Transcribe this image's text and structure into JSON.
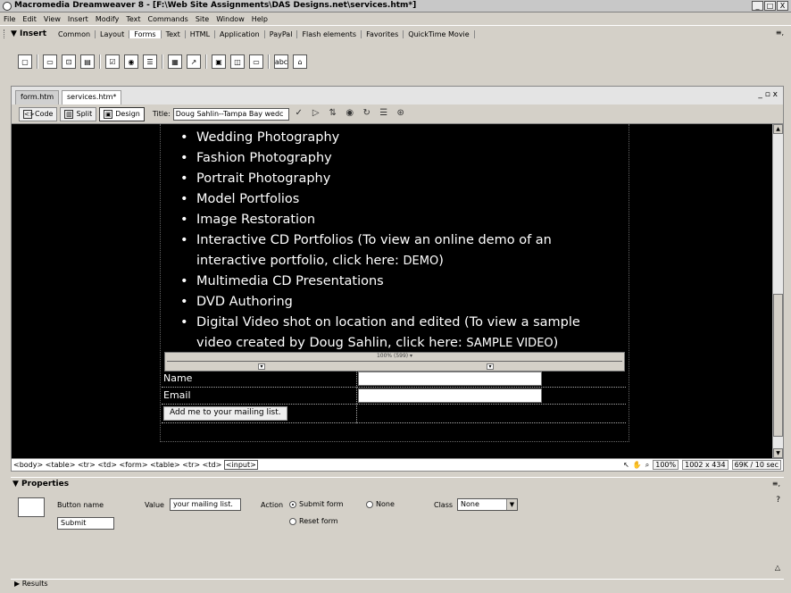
{
  "window": {
    "title": "Macromedia Dreamweaver 8 - [F:\\Web Site Assignments\\DAS Designs.net\\services.htm*]",
    "controls": [
      "_",
      "□",
      "X"
    ]
  },
  "menubar": [
    "File",
    "Edit",
    "View",
    "Insert",
    "Modify",
    "Text",
    "Commands",
    "Site",
    "Window",
    "Help"
  ],
  "insert_bar": {
    "label": "▼ Insert",
    "tabs": [
      "Common",
      "Layout",
      "Forms",
      "Text",
      "HTML",
      "Application",
      "PayPal",
      "Flash elements",
      "Favorites",
      "QuickTime Movie"
    ],
    "active_tab": "Forms",
    "menu_glyph": "≡,"
  },
  "document": {
    "tabs": [
      "form.htm",
      "services.htm*"
    ],
    "active_tab": "services.htm*",
    "window_controls": "_ ▫ x",
    "views": [
      {
        "label": "Code"
      },
      {
        "label": "Split"
      },
      {
        "label": "Design"
      }
    ],
    "active_view": "Design",
    "title_label": "Title:",
    "title_value": "Doug Sahlin--Tampa Bay wedc"
  },
  "services": [
    {
      "text": "Wedding Photography"
    },
    {
      "text": "Fashion Photography"
    },
    {
      "text": "Portrait Photography"
    },
    {
      "text": "Model Portfolios"
    },
    {
      "text": "Image Restoration"
    },
    {
      "text": "Interactive CD Portfolios (To view an online demo of an interactive portfolio, click here: ",
      "link": "DEMO",
      "tail": ")"
    },
    {
      "text": "Multimedia CD Presentations"
    },
    {
      "text": "DVD Authoring"
    },
    {
      "text": "Digital Video shot on location and edited (To view a sample video created by Doug Sahlin, click here: ",
      "link": "SAMPLE VIDEO",
      "tail": ")"
    }
  ],
  "form_table": {
    "ruler_label": "100% (599) ▾",
    "name_label": "Name",
    "email_label": "Email",
    "submit_label": "Add me to your mailing list."
  },
  "status_bar": {
    "tag_path": "<body> <table> <tr> <td> <form> <table> <tr> <td>",
    "selected_tag": "<input>",
    "zoom": "100%",
    "size": "1002 x 434",
    "download": "69K / 10 sec"
  },
  "properties": {
    "title": "▼ Properties",
    "button_name_label": "Button name",
    "button_name_value": "Submit",
    "value_label": "Value",
    "value_value": "your mailing list.",
    "action_label": "Action",
    "action_options": [
      "Submit form",
      "None",
      "Reset form"
    ],
    "action_selected": "Submit form",
    "class_label": "Class",
    "class_value": "None"
  },
  "results_panel": {
    "label": "▶ Results"
  }
}
